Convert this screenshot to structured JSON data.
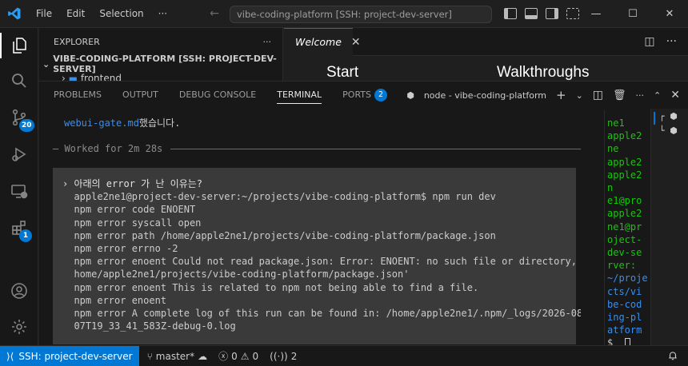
{
  "titlebar": {
    "menu": [
      "File",
      "Edit",
      "Selection",
      "···"
    ],
    "command_center": "vibe-coding-platform [SSH: project-dev-server]"
  },
  "activity_bar": {
    "source_control_badge": "20",
    "extensions_badge": "1"
  },
  "explorer": {
    "title": "EXPLORER",
    "more": "···",
    "root_label": "VIBE-CODING-PLATFORM [SSH: PROJECT-DEV-SERVER]",
    "child": "frontend"
  },
  "editor": {
    "tab_label": "Welcome",
    "heading_start": "Start",
    "heading_walkthroughs": "Walkthroughs"
  },
  "panel": {
    "tabs": [
      "PROBLEMS",
      "OUTPUT",
      "DEBUG CONSOLE",
      "TERMINAL",
      "PORTS"
    ],
    "ports_badge": "2",
    "terminal_name": "node - vibe-coding-platform"
  },
  "terminal": {
    "top_link": "webui-gate.md",
    "top_suffix": "했습니다.",
    "worked": "— Worked for 2m 28s",
    "lines": [
      "› 아래의 error 가 난 이유는?",
      "  apple2ne1@project-dev-server:~/projects/vibe-coding-platform$ npm run dev",
      "  npm error code ENOENT",
      "  npm error syscall open",
      "  npm error path /home/apple2ne1/projects/vibe-coding-platform/package.json",
      "  npm error errno -2",
      "  npm error enoent Could not read package.json: Error: ENOENT: no such file or directory, open '/",
      "  home/apple2ne1/projects/vibe-coding-platform/package.json'",
      "  npm error enoent This is related to npm not being able to find a file.",
      "  npm error enoent",
      "  npm error A complete log of this run can be found in: /home/apple2ne1/.npm/_logs/2026-08-",
      "  07T19_33_41_583Z-debug-0.log"
    ],
    "side_green": [
      "ne1",
      "apple2",
      "ne",
      "apple2",
      "apple2",
      "n",
      "e1@pro",
      "apple2",
      "ne1@pr",
      "oject-",
      "dev-se",
      "rver:"
    ],
    "side_blue": [
      "~/proje",
      "cts/vi",
      "be-cod",
      "ing-pl",
      "atform"
    ],
    "side_prompt": "$"
  },
  "statusbar": {
    "remote": "SSH: project-dev-server",
    "branch": "master*",
    "errors": "0",
    "warnings": "0",
    "ports": "2"
  }
}
